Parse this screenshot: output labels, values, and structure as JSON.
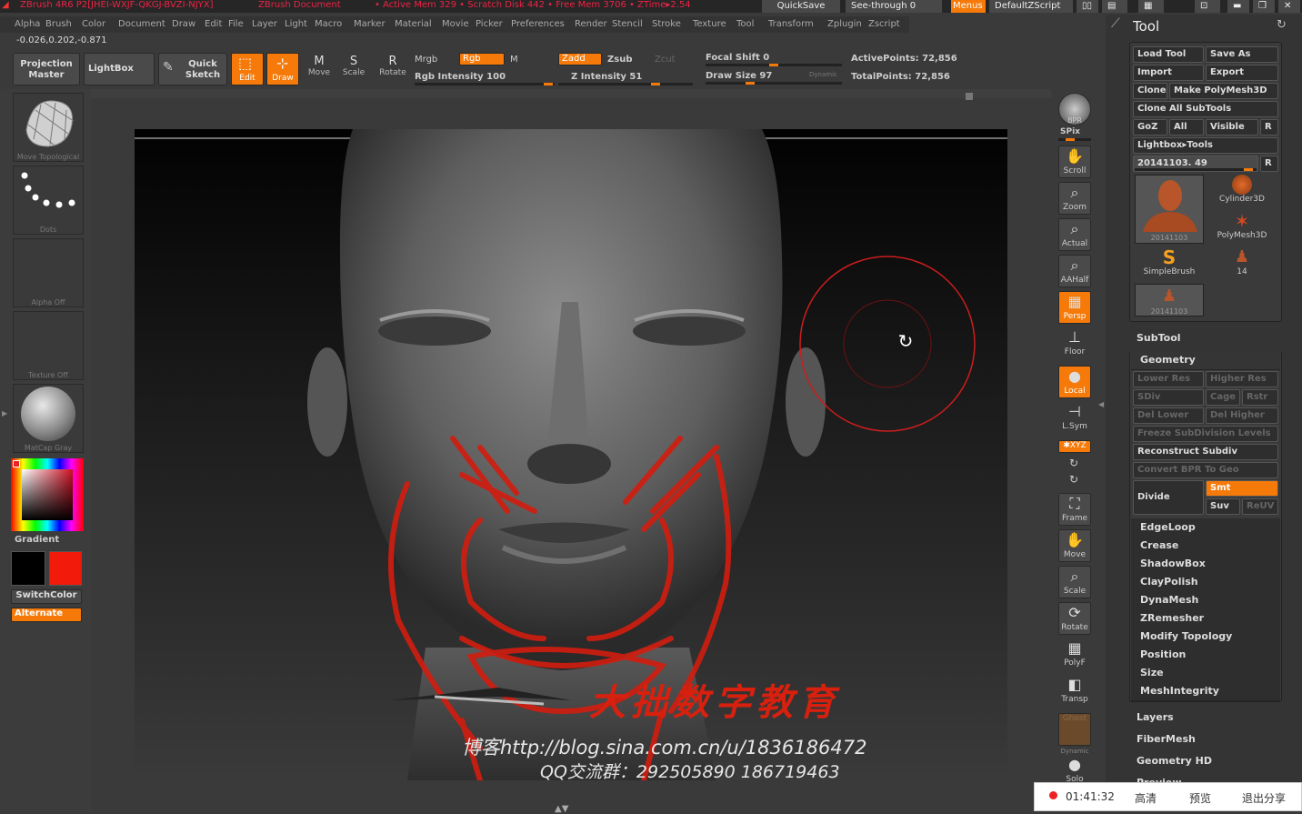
{
  "titlebar": {
    "app": "ZBrush 4R6 P2[JHEI-WXJF-QKGJ-BVZI-NJYX]",
    "document": "ZBrush Document",
    "stats": "• Active Mem 329 • Scratch Disk 442 • Free Mem 3706 • ZTime▸2.54",
    "quicksave": "QuickSave",
    "seethrough": "See-through  0",
    "menus": "Menus",
    "script": "DefaultZScript"
  },
  "menu": [
    "Alpha",
    "Brush",
    "Color",
    "Document",
    "Draw",
    "Edit",
    "File",
    "Layer",
    "Light",
    "Macro",
    "Marker",
    "Material",
    "Movie",
    "Picker",
    "Preferences",
    "Render",
    "Stencil",
    "Stroke",
    "Texture",
    "Tool",
    "Transform",
    "Zplugin",
    "Zscript"
  ],
  "coords": "-0.026,0.202,-0.871",
  "topbar": {
    "projection_master": "Projection\nMaster",
    "lightbox": "LightBox",
    "quick_sketch": "Quick\nSketch",
    "edit": "Edit",
    "draw": "Draw",
    "move": "Move",
    "scale": "Scale",
    "rotate": "Rotate",
    "mrgb": "Mrgb",
    "rgb": "Rgb",
    "m": "M",
    "rgb_intensity": "Rgb  Intensity 100",
    "zadd": "Zadd",
    "zsub": "Zsub",
    "zcut": "Zcut",
    "z_intensity": "Z Intensity 51",
    "focal_shift": "Focal Shift 0",
    "draw_size": "Draw Size 97",
    "dynamic": "Dynamic",
    "active_points": "ActivePoints: 72,856",
    "total_points": "TotalPoints: 72,856"
  },
  "left": {
    "brush_caption": "Move Topological",
    "stroke_caption": "Dots",
    "alpha_caption": "Alpha  Off",
    "texture_caption": "Texture  Off",
    "material_caption": "MatCap  Gray",
    "gradient": "Gradient",
    "switchcolor": "SwitchColor",
    "alternate": "Alternate"
  },
  "shelf": {
    "bpr": "BPR",
    "spix": "SPix",
    "scroll": "Scroll",
    "zoom": "Zoom",
    "actual": "Actual",
    "aahalf": "AAHalf",
    "persp": "Persp",
    "floor": "Floor",
    "local": "Local",
    "lsym": "L.Sym",
    "xyz": "✱XYZ",
    "frame": "Frame",
    "move": "Move",
    "scale": "Scale",
    "rotate": "Rotate",
    "polyf": "PolyF",
    "transp": "Transp",
    "ghost": "Ghost",
    "dynamic": "Dynamic",
    "solo": "Solo"
  },
  "tool": {
    "title": "Tool",
    "load": "Load Tool",
    "save": "Save As",
    "import": "Import",
    "export": "Export",
    "clone": "Clone",
    "make_poly": "Make PolyMesh3D",
    "clone_all": "Clone All SubTools",
    "goz": "GoZ",
    "all": "All",
    "visible": "Visible",
    "r": "R",
    "lightbox_tools": "Lightbox▸Tools",
    "current": "20141103. 49",
    "thumbs": [
      {
        "label": "20141103"
      },
      {
        "label": "Cylinder3D"
      },
      {
        "label": "PolyMesh3D"
      },
      {
        "label": "SimpleBrush"
      },
      {
        "label": "14"
      },
      {
        "label": "20141103"
      }
    ],
    "subtool": "SubTool",
    "geometry": "Geometry",
    "lower_res": "Lower Res",
    "higher_res": "Higher Res",
    "sdiv": "SDiv",
    "cage": "Cage",
    "rstr": "Rstr",
    "del_lower": "Del Lower",
    "del_higher": "Del Higher",
    "freeze": "Freeze SubDivision Levels",
    "reconstruct": "Reconstruct Subdiv",
    "convert_bpr": "Convert BPR To Geo",
    "divide": "Divide",
    "smt": "Smt",
    "suv": "Suv",
    "reuv": "ReUV",
    "sections": [
      "EdgeLoop",
      "Crease",
      "ShadowBox",
      "ClayPolish",
      "DynaMesh",
      "ZRemesher",
      "Modify Topology",
      "Position",
      "Size",
      "MeshIntegrity"
    ],
    "more": [
      "Layers",
      "FiberMesh",
      "Geometry HD",
      "Preview"
    ]
  },
  "watermark": {
    "brand": "大拙数字教育",
    "blog": "博客http://blog.sina.com.cn/u/1836186472",
    "qq": "QQ交流群：292505890  186719463"
  },
  "status": {
    "time": "01:41:32",
    "hd": "高清",
    "preview": "预览",
    "exit": "退出分享"
  },
  "colors": {
    "accent": "#f57a0a",
    "brush_red": "#d21d0f"
  }
}
